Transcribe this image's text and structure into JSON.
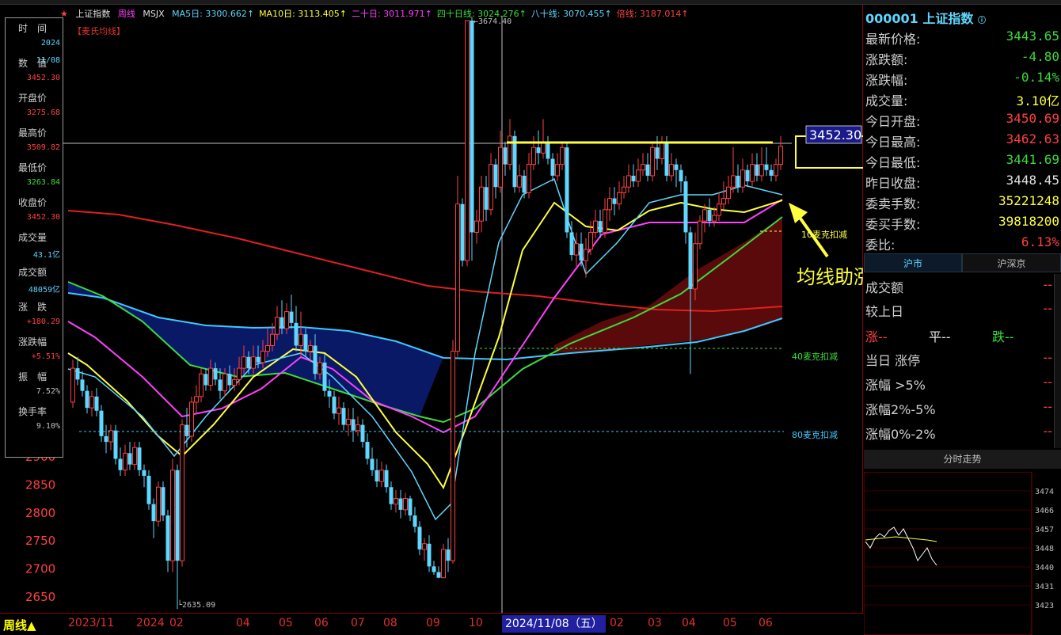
{
  "chart": {
    "index_name": "上证指数",
    "period": "周线",
    "indicator": "MSJX",
    "indicator_label": "【麦氏均线】",
    "ma_labels": [
      {
        "name": "MA5日",
        "value": "3300.662",
        "color": "#5fd7ff"
      },
      {
        "name": "MA10日",
        "value": "3113.405",
        "color": "#ffff40"
      },
      {
        "name": "二十日",
        "value": "3011.971",
        "color": "#ff40ff"
      },
      {
        "name": "四十日线",
        "value": "3024.276",
        "color": "#3cdc3c"
      },
      {
        "name": "八十线",
        "value": "3070.455",
        "color": "#5fd7ff"
      },
      {
        "name": "倍线",
        "value": "3187.014",
        "color": "#ff4040"
      }
    ],
    "peak_label": "3674.40",
    "low_label": "2635.09",
    "price_box": "3452.30",
    "annotation": "均线助涨",
    "deduct_labels": [
      "10麦克扣减",
      "40麦克扣减",
      "80麦克扣减"
    ],
    "y_ticks": [
      "2900",
      "2850",
      "2800",
      "2750",
      "2700",
      "2650"
    ],
    "x_ticks": [
      "2023/11",
      "2024",
      "02",
      "04",
      "05",
      "06",
      "07",
      "08",
      "09",
      "10",
      "02",
      "03",
      "04",
      "05",
      "06"
    ],
    "cursor_date": "2024/11/08（五）"
  },
  "info_panel": [
    {
      "label": "时　间",
      "value1": "2024",
      "value2": "11/08",
      "color": "#5fd7ff"
    },
    {
      "label": "数　值",
      "value": "3452.30",
      "color": "#ff4040"
    },
    {
      "label": "开盘价",
      "value": "3275.68",
      "color": "#ff4040"
    },
    {
      "label": "最高价",
      "value": "3509.82",
      "color": "#ff4040"
    },
    {
      "label": "最低价",
      "value": "3263.84",
      "color": "#3cdc3c"
    },
    {
      "label": "收盘价",
      "value": "3452.30",
      "color": "#ff4040"
    },
    {
      "label": "成交量",
      "value": "43.1亿",
      "color": "#5fd7ff"
    },
    {
      "label": "成交额",
      "value": "48059亿",
      "color": "#5fd7ff"
    },
    {
      "label": "涨　跌",
      "value": "+180.29",
      "color": "#ff4040"
    },
    {
      "label": "涨跌幅",
      "value": "+5.51%",
      "color": "#ff4040"
    },
    {
      "label": "振　幅",
      "value": "7.52%",
      "color": "#c0c0c0"
    },
    {
      "label": "换手率",
      "value": "9.10%",
      "color": "#c0c0c0"
    }
  ],
  "quote": {
    "code": "000001",
    "name": "上证指数",
    "rows": [
      {
        "label": "最新价格:",
        "value": "3443.65",
        "cls": "green"
      },
      {
        "label": "涨跌额:",
        "value": "-4.80",
        "cls": "green"
      },
      {
        "label": "涨跌幅:",
        "value": "-0.14%",
        "cls": "green"
      },
      {
        "label": "成交量:",
        "value": "3.10亿",
        "cls": "yellow"
      },
      {
        "label": "今日开盘:",
        "value": "3450.69",
        "cls": "red"
      },
      {
        "label": "今日最高:",
        "value": "3462.63",
        "cls": "red"
      },
      {
        "label": "今日最低:",
        "value": "3441.69",
        "cls": "green"
      },
      {
        "label": "昨日收盘:",
        "value": "3448.45",
        "cls": "white"
      },
      {
        "label": "委卖手数:",
        "value": "35221248",
        "cls": "yellow"
      },
      {
        "label": "委买手数:",
        "value": "39818200",
        "cls": "yellow"
      },
      {
        "label": "委比:",
        "value": "6.13%",
        "cls": "red"
      }
    ]
  },
  "market_tabs": [
    "沪市",
    "沪深京"
  ],
  "breadth": {
    "rows": [
      {
        "label": "成交额",
        "value": "--"
      },
      {
        "label": "较上日",
        "value": "--"
      },
      {
        "label": "当日 涨停",
        "value": "--"
      },
      {
        "label": "涨幅 >5%",
        "value": "--"
      },
      {
        "label": "涨幅2%-5%",
        "value": "--"
      },
      {
        "label": "涨幅0%-2%",
        "value": "--"
      }
    ],
    "up": "涨--",
    "flat": "平--",
    "down": "跌--"
  },
  "intraday": {
    "title": "分时走势",
    "y_ticks": [
      "3474",
      "3466",
      "3457",
      "3448",
      "3440",
      "3431",
      "3423"
    ]
  },
  "colors": {
    "up": "#ff4040",
    "down": "#5fd7ff",
    "ma5": "#5fd7ff",
    "ma10": "#ffff40",
    "ma20": "#ff40ff",
    "ma40": "#3cdc3c",
    "ma80": "#40c8ff",
    "ma_long": "#e02020",
    "annotation": "#ffff40"
  }
}
